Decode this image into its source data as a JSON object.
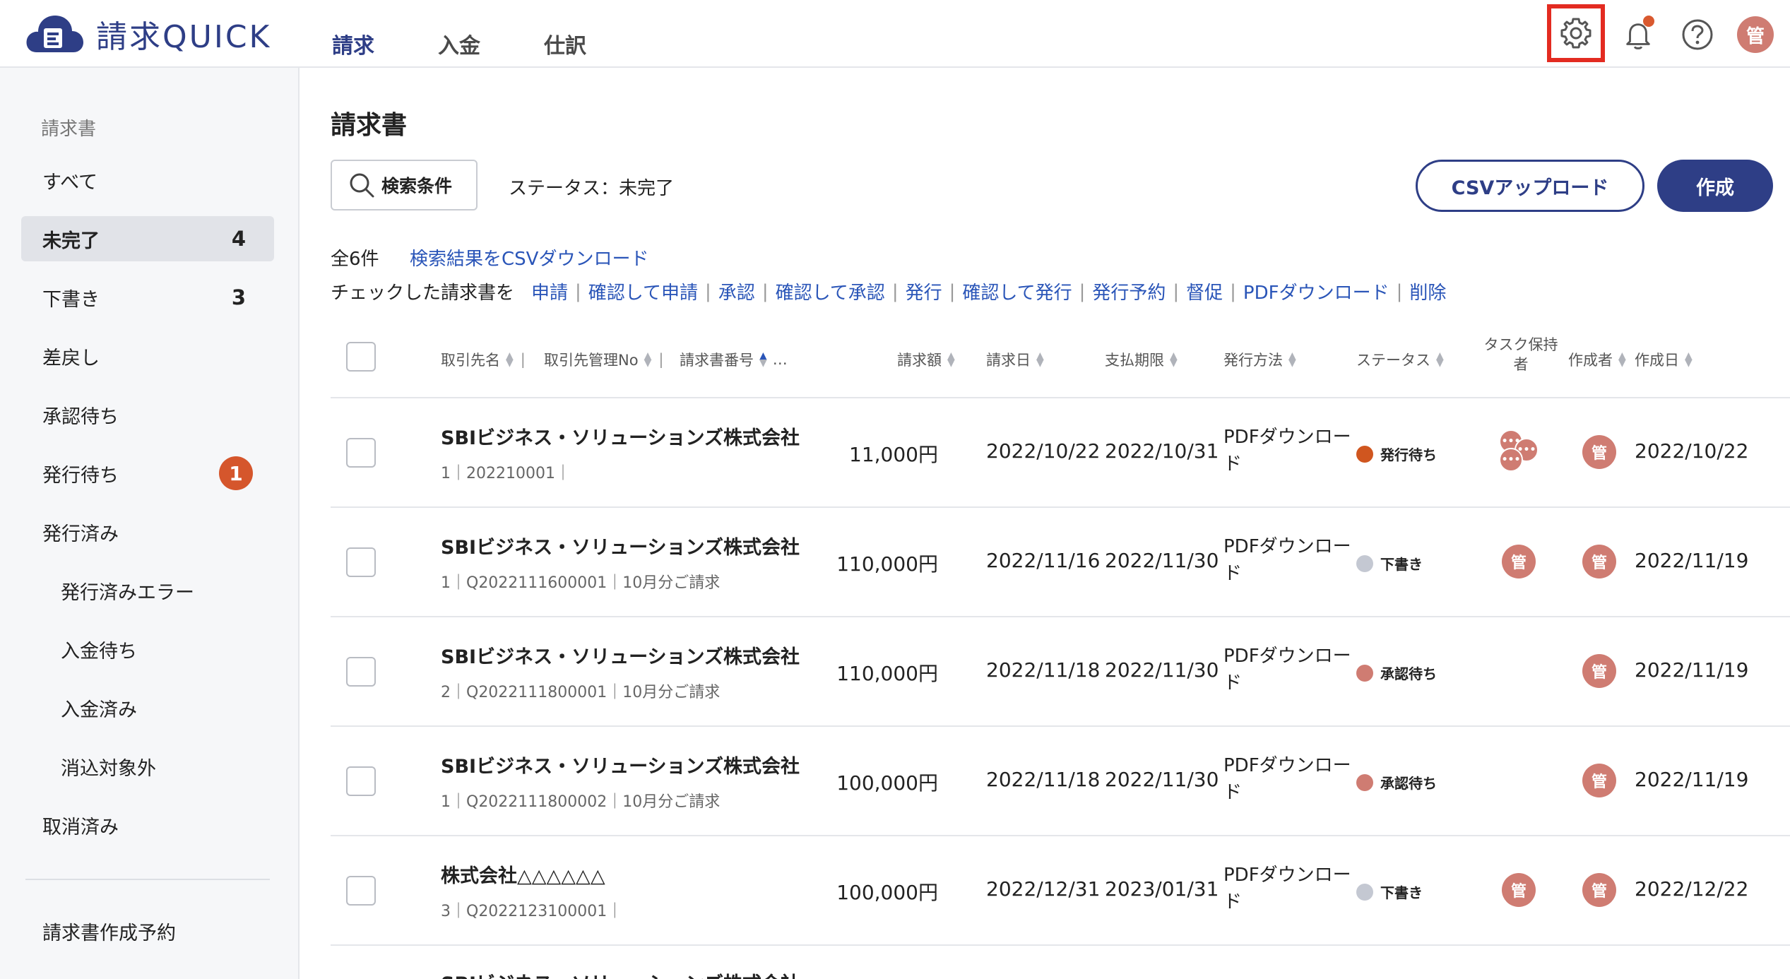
{
  "header": {
    "logo_text": "請求QUICK",
    "nav": [
      {
        "label": "請求",
        "active": true
      },
      {
        "label": "入金",
        "active": false
      },
      {
        "label": "仕訳",
        "active": false
      }
    ],
    "avatar_initial": "管",
    "icons": [
      "gear-icon",
      "bell-icon",
      "help-icon"
    ]
  },
  "sidebar": {
    "section_label": "請求書",
    "items": [
      {
        "label": "すべて"
      },
      {
        "label": "未完了",
        "count": "4",
        "active": true
      },
      {
        "label": "下書き",
        "count": "3"
      },
      {
        "label": "差戻し"
      },
      {
        "label": "承認待ち"
      },
      {
        "label": "発行待ち",
        "badge": "1"
      },
      {
        "label": "発行済み"
      },
      {
        "label": "発行済みエラー"
      },
      {
        "label": "入金待ち"
      },
      {
        "label": "入金済み"
      },
      {
        "label": "消込対象外"
      },
      {
        "label": "取消済み"
      }
    ],
    "footer_item": "請求書作成予約"
  },
  "main": {
    "title": "請求書",
    "search_label": "検索条件",
    "status_filter": "ステータス：未完了",
    "csv_upload_label": "CSVアップロード",
    "create_label": "作成",
    "total_count": "全6件",
    "csv_download_link": "検索結果をCSVダウンロード",
    "bulk_label": "チェックした請求書を",
    "bulk_actions": [
      "申請",
      "確認して申請",
      "承認",
      "確認して承認",
      "発行",
      "確認して発行",
      "発行予約",
      "督促",
      "PDFダウンロード",
      "削除"
    ]
  },
  "table": {
    "columns": {
      "client": "取引先名",
      "client_no": "取引先管理No",
      "invoice_no": "請求書番号",
      "more": "…",
      "amount": "請求額",
      "invoice_date": "請求日",
      "due_date": "支払期限",
      "method": "発行方法",
      "status": "ステータス",
      "task_holder": "タスク保持者",
      "author": "作成者",
      "created": "作成日"
    },
    "rows": [
      {
        "client": "SBIビジネス・ソリューションズ株式会社",
        "ids": "1｜202210001｜",
        "amount": "11,000円",
        "invoice_date": "2022/10/22",
        "due_date": "2022/10/31",
        "method": "PDFダウンロード",
        "status": "発行待ち",
        "status_color": "#d0561f",
        "task": "group",
        "author": "管",
        "created": "2022/10/22"
      },
      {
        "client": "SBIビジネス・ソリューションズ株式会社",
        "ids": "1｜Q2022111600001｜10月分ご請求",
        "amount": "110,000円",
        "invoice_date": "2022/11/16",
        "due_date": "2022/11/30",
        "method": "PDFダウンロード",
        "status": "下書き",
        "status_color": "#c4c8d2",
        "task": "管",
        "author": "管",
        "created": "2022/11/19"
      },
      {
        "client": "SBIビジネス・ソリューションズ株式会社",
        "ids": "2｜Q2022111800001｜10月分ご請求",
        "amount": "110,000円",
        "invoice_date": "2022/11/18",
        "due_date": "2022/11/30",
        "method": "PDFダウンロード",
        "status": "承認待ち",
        "status_color": "#cf7c72",
        "task": "",
        "author": "管",
        "created": "2022/11/19"
      },
      {
        "client": "SBIビジネス・ソリューションズ株式会社",
        "ids": "1｜Q2022111800002｜10月分ご請求",
        "amount": "100,000円",
        "invoice_date": "2022/11/18",
        "due_date": "2022/11/30",
        "method": "PDFダウンロード",
        "status": "承認待ち",
        "status_color": "#cf7c72",
        "task": "",
        "author": "管",
        "created": "2022/11/19"
      },
      {
        "client": "株式会社△△△△△△",
        "ids": "3｜Q2022123100001｜",
        "amount": "100,000円",
        "invoice_date": "2022/12/31",
        "due_date": "2023/01/31",
        "method": "PDFダウンロード",
        "status": "下書き",
        "status_color": "#c4c8d2",
        "task": "管",
        "author": "管",
        "created": "2022/12/22"
      }
    ],
    "partial_row_client": "SBIビジネス・ソリューションズ株式会社"
  },
  "colors": {
    "brand": "#2e3e86",
    "link": "#2a55b8",
    "badge": "#d5562c",
    "avatar": "#cf7c72",
    "highlight": "#e32b21"
  }
}
